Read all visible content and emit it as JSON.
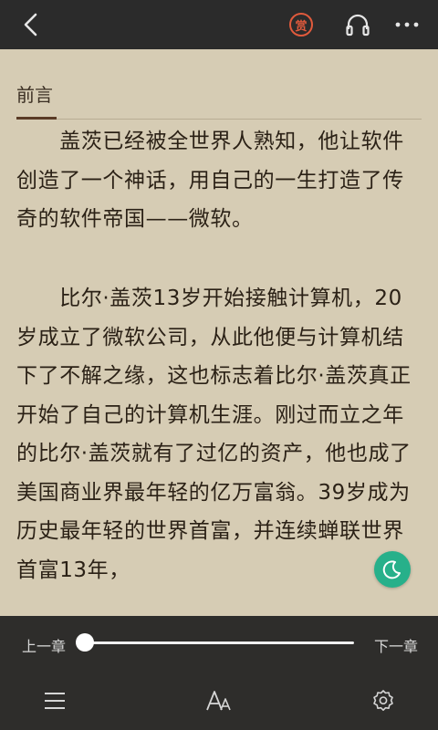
{
  "topbar": {
    "reward_label": "赏"
  },
  "chapter": {
    "title": "前言",
    "paragraphs": [
      "　　盖茨已经被全世界人熟知，他让软件创造了一个神话，用自己的一生打造了传奇的软件帝国——微软。",
      "　　比尔·盖茨13岁开始接触计算机，20岁成立了微软公司，从此他便与计算机结下了不解之缘，这也标志着比尔·盖茨真正开始了自己的计算机生涯。刚过而立之年的比尔·盖茨就有了过亿的资产，他也成了美国商业界最年轻的亿万富翁。39岁成为历史最年轻的世界首富，并连续蝉联世界首富13年，"
    ]
  },
  "bottom": {
    "prev_label": "上一章",
    "next_label": "下一章",
    "progress": 0
  },
  "colors": {
    "page_background": "#d6ccb4",
    "toolbar_background": "#2b2b2b",
    "accent_green": "#27b08a",
    "reward_red": "#e05a3c"
  },
  "icons": [
    "back-arrow-icon",
    "reward-icon",
    "headphones-icon",
    "more-dots-icon",
    "moon-icon",
    "menu-list-icon",
    "font-size-icon",
    "settings-gear-icon"
  ]
}
